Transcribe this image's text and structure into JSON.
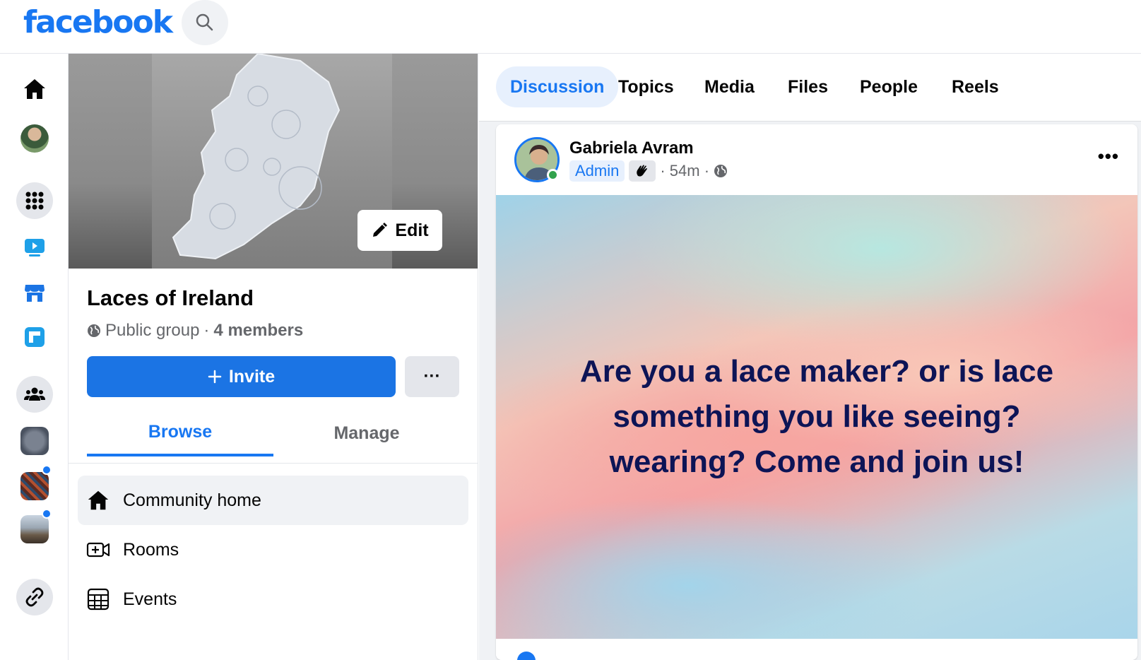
{
  "header": {
    "logo_text": "facebook",
    "search_icon": "search-icon"
  },
  "rail": {
    "items": [
      {
        "name": "home-icon"
      },
      {
        "name": "profile-avatar"
      },
      {
        "name": "menu-grid-icon"
      },
      {
        "name": "watch-icon"
      },
      {
        "name": "marketplace-icon"
      },
      {
        "name": "feeds-icon"
      },
      {
        "name": "groups-icon"
      },
      {
        "name": "group-shortcut-1"
      },
      {
        "name": "group-shortcut-2"
      },
      {
        "name": "group-shortcut-3"
      },
      {
        "name": "link-icon"
      }
    ]
  },
  "group": {
    "edit_label": "Edit",
    "name": "Laces of Ireland",
    "privacy": "Public group",
    "separator": "·",
    "members": "4 members",
    "invite_label": "Invite",
    "more_label": "···",
    "tabs": {
      "browse": "Browse",
      "manage": "Manage"
    },
    "nav": [
      {
        "label": "Community home",
        "icon": "home-icon"
      },
      {
        "label": "Rooms",
        "icon": "video-plus-icon"
      },
      {
        "label": "Events",
        "icon": "calendar-icon"
      }
    ]
  },
  "main": {
    "tabs": [
      "Discussion",
      "Topics",
      "Media",
      "Files",
      "People",
      "Reels"
    ],
    "active_tab": "Discussion",
    "post": {
      "author": "Gabriela Avram",
      "badge": "Admin",
      "time": "· 54m ·",
      "more_label": "•••",
      "text": "Are you a lace maker? or is lace something you like seeing? wearing? Come and join us!"
    }
  },
  "colors": {
    "brand": "#1877f2",
    "invite": "#1b74e4",
    "post_text": "#0d1456"
  }
}
